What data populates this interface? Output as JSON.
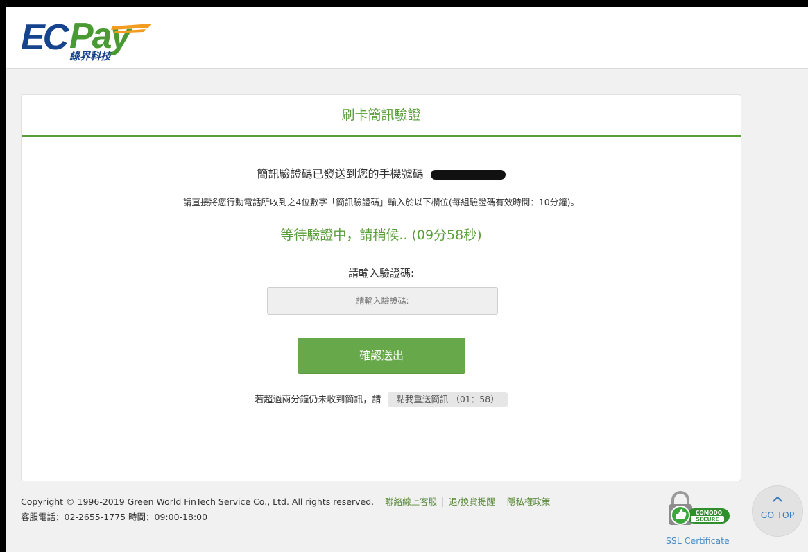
{
  "header": {
    "logo_main_ec": "EC",
    "logo_main_pay": "Pay",
    "logo_sub": "綠界科技"
  },
  "card": {
    "title": "刷卡簡訊驗證",
    "sent_message": "簡訊驗證碼已發送到您的手機號碼",
    "instruction": "請直接將您行動電話所收到之4位數字「簡訊驗證碼」輸入於以下欄位(每組驗證碼有效時間：10分鐘)。",
    "waiting_status": "等待驗證中，請稍候.. (09分58秒)",
    "input_label": "請輸入驗證碼:",
    "input_placeholder": "請輸入驗證碼:",
    "input_value": "",
    "submit_label": "確認送出",
    "resend_prompt": "若超過兩分鐘仍未收到簡訊，請",
    "resend_button": "點我重送簡訊 （01：58）"
  },
  "footer": {
    "copyright": "Copyright © 1996-2019 Green World FinTech Service Co., Ltd. All rights reserved.",
    "links": [
      "聯絡線上客服",
      "退/換貨提醒",
      "隱私權政策"
    ],
    "service_hours": "客服電話：02-2655-1775 時間：09:00-18:00",
    "ssl_badge_top": "COMODO",
    "ssl_badge_bottom": "SECURE",
    "ssl_label": "SSL Certificate",
    "go_top": "GO TOP"
  },
  "colors": {
    "brand_green": "#5a9e3a",
    "brand_blue": "#16438e",
    "button_green": "#67a84b",
    "link_blue": "#3a7bbf",
    "accent_orange": "#f39c1f"
  }
}
